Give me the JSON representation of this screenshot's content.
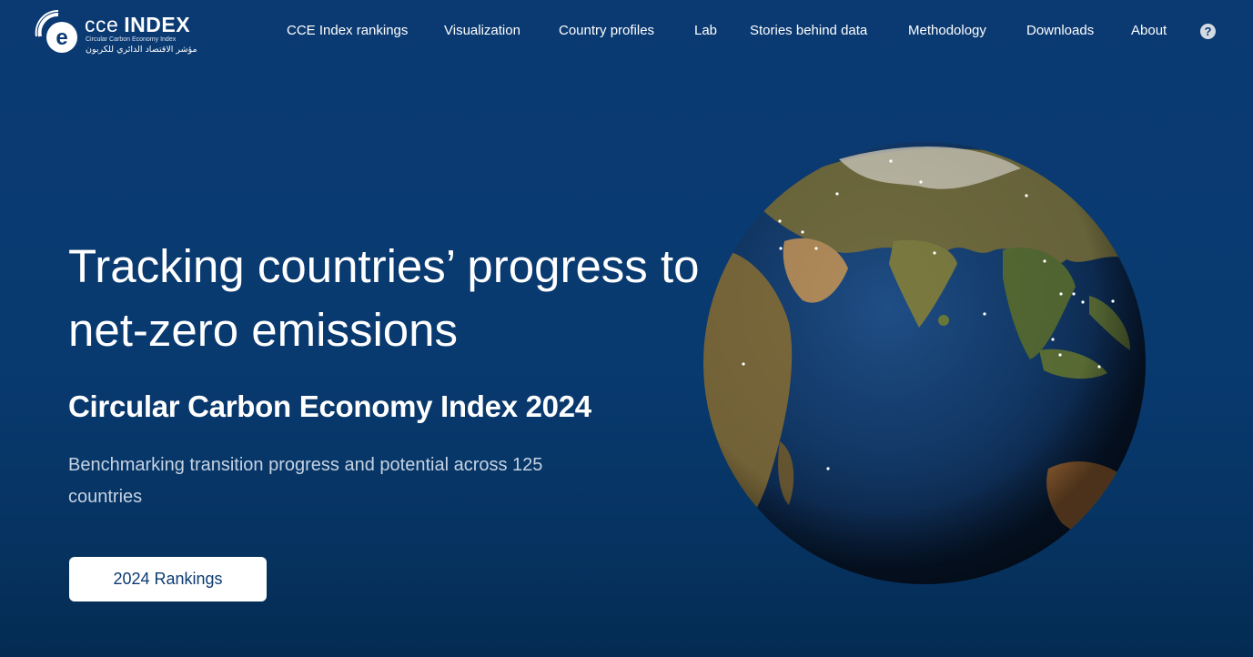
{
  "logo": {
    "title_light": "cce",
    "title_bold": "INDEX",
    "subtitle": "Circular Carbon Economy Index",
    "arabic": "مؤشر الاقتصاد الدائري للكربون"
  },
  "nav": {
    "items": [
      "CCE Index rankings",
      "Visualization",
      "Country profiles",
      "Lab",
      "Stories behind data",
      "Methodology",
      "Downloads",
      "About"
    ],
    "help_label": "?"
  },
  "hero": {
    "title": "Tracking countries’ progress to net-zero emissions",
    "subtitle": "Circular Carbon Economy Index 2024",
    "description": "Benchmarking transition progress and potential across 125 countries",
    "button_label": "2024 Rankings"
  },
  "colors": {
    "background": "#0b3a72",
    "button_text": "#0b3a72",
    "text": "#ffffff"
  }
}
